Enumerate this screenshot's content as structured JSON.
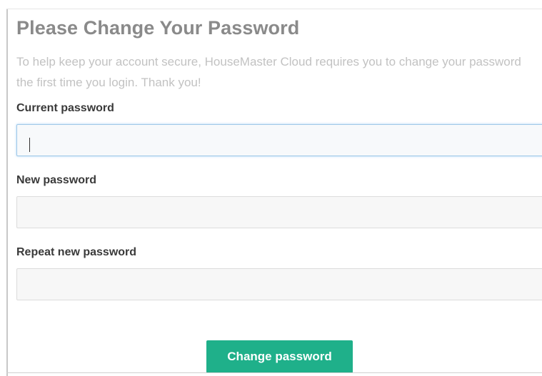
{
  "form": {
    "title": "Please Change Your Password",
    "intro": "To help keep your account secure, HouseMaster Cloud requires you to change your password the first time you login. Thank you!",
    "current_password_label": "Current password",
    "current_password_value": "",
    "new_password_label": "New password",
    "new_password_value": "",
    "repeat_password_label": "Repeat new password",
    "repeat_password_value": "",
    "submit_label": "Change password"
  },
  "colors": {
    "accent": "#1fb08a",
    "title_text": "#8a8a8a",
    "intro_text": "#c2c2c2",
    "focus_border": "#9fc8e8"
  }
}
